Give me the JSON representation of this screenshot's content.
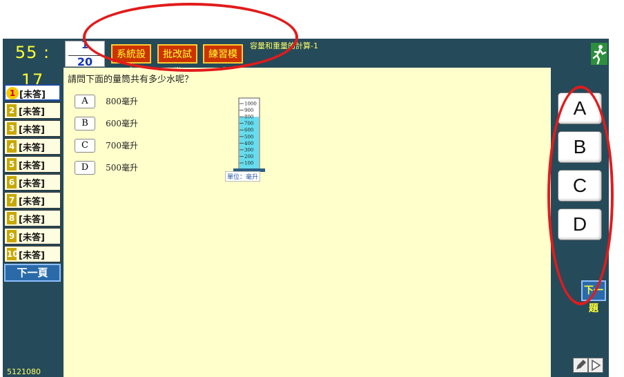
{
  "header": {
    "timer": "55 : 17",
    "question_counter": {
      "current": "1",
      "total": "20"
    },
    "menu": [
      {
        "label": "系統設定"
      },
      {
        "label": "批改試卷"
      },
      {
        "label": "練習模式"
      }
    ],
    "topic": "容量和重量的計算-1",
    "exit_icon": "running-man-exit-icon"
  },
  "sidebar": {
    "items": [
      {
        "num": "1",
        "label": "[未答]"
      },
      {
        "num": "2",
        "label": "[未答]"
      },
      {
        "num": "3",
        "label": "[未答]"
      },
      {
        "num": "4",
        "label": "[未答]"
      },
      {
        "num": "5",
        "label": "[未答]"
      },
      {
        "num": "6",
        "label": "[未答]"
      },
      {
        "num": "7",
        "label": "[未答]"
      },
      {
        "num": "8",
        "label": "[未答]"
      },
      {
        "num": "9",
        "label": "[未答]"
      },
      {
        "num": "10",
        "label": "[未答]"
      }
    ],
    "next_page_label": "下一頁",
    "exam_id": "5121080"
  },
  "question": {
    "text": "請問下面的量筒共有多少水呢？",
    "options": [
      {
        "key": "A",
        "text": "800毫升"
      },
      {
        "key": "B",
        "text": "600毫升"
      },
      {
        "key": "C",
        "text": "700毫升"
      },
      {
        "key": "D",
        "text": "500毫升"
      }
    ],
    "figure": {
      "scale": [
        "1000",
        "900",
        "800",
        "700",
        "600",
        "500",
        "400",
        "300",
        "200",
        "100"
      ],
      "fill_level": 0.8,
      "unit_label": "單位：毫升"
    }
  },
  "answer_buttons": [
    "A",
    "B",
    "C",
    "D"
  ],
  "next_question_label": "下一題",
  "colors": {
    "annotation": "#e21b1b",
    "background_panel": "#254a5a",
    "content_area": "#ffffcc",
    "water": "#66ddee"
  }
}
